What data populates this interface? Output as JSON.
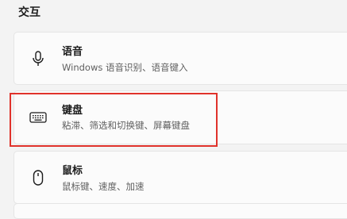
{
  "section": {
    "title": "交互"
  },
  "items": [
    {
      "id": "speech",
      "icon": "microphone-icon",
      "title": "语音",
      "subtitle": "Windows 语音识别、语音键入"
    },
    {
      "id": "keyboard",
      "icon": "keyboard-icon",
      "title": "键盘",
      "subtitle": "粘滞、筛选和切换键、屏幕键盘",
      "highlighted": true
    },
    {
      "id": "mouse",
      "icon": "mouse-icon",
      "title": "鼠标",
      "subtitle": "鼠标键、速度、加速"
    }
  ],
  "colors": {
    "highlight": "#e0322b",
    "card_background": "#fbfbfb",
    "page_background": "#f3f3f3"
  }
}
